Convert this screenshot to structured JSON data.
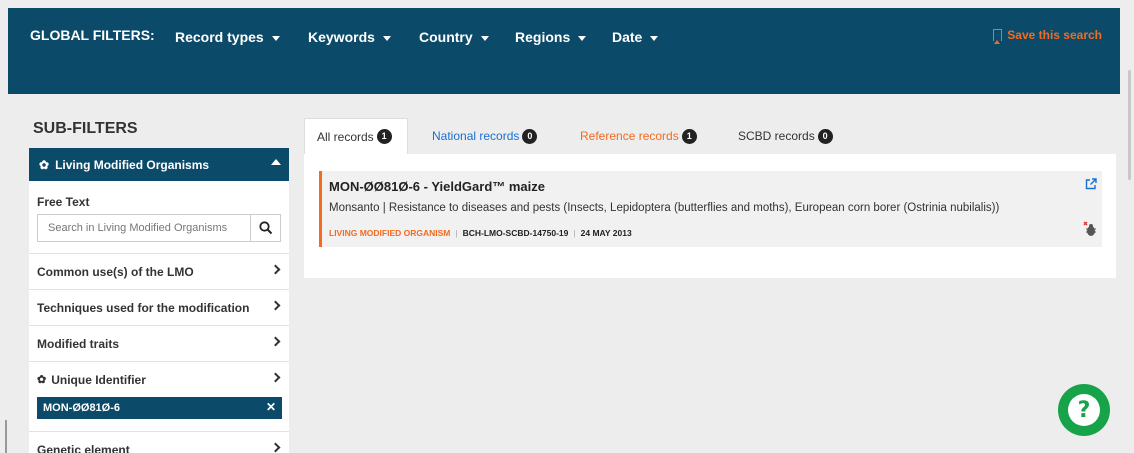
{
  "global_filters": {
    "label": "GLOBAL FILTERS:",
    "menus": [
      "Record types",
      "Keywords",
      "Country",
      "Regions",
      "Date"
    ],
    "save_search": "Save this search"
  },
  "sub_filters": {
    "title": "SUB-FILTERS",
    "section_header": "Living Modified Organisms",
    "free_text_label": "Free Text",
    "search_placeholder": "Search in Living Modified Organisms",
    "facets": [
      "Common use(s) of the LMO",
      "Techniques used for the modification",
      "Modified traits",
      "Unique Identifier",
      "Genetic element"
    ],
    "selected_chip": "MON-ØØ81Ø-6"
  },
  "tabs": [
    {
      "label": "All records",
      "count": "1",
      "color": "#333333"
    },
    {
      "label": "National records",
      "count": "0",
      "color": "#1a6fd1"
    },
    {
      "label": "Reference records",
      "count": "1",
      "color": "#f26b21"
    },
    {
      "label": "SCBD records",
      "count": "0",
      "color": "#333333"
    }
  ],
  "record": {
    "title": "MON-ØØ81Ø-6 - YieldGard™ maize",
    "description": "Monsanto | Resistance to diseases and pests (Insects, Lepidoptera (butterflies and moths), European corn borer (Ostrinia nubilalis))",
    "type": "LIVING MODIFIED ORGANISM",
    "id": "BCH-LMO-SCBD-14750-19",
    "date": "24 MAY 2013"
  },
  "colors": {
    "navy": "#0c4a6a",
    "orange": "#f26b21",
    "green": "#16a34a"
  },
  "icons": [
    "caret-down-icon",
    "bookmark-icon",
    "gear-icon",
    "caret-up-icon",
    "search-icon",
    "chevron-right-icon",
    "close-icon",
    "external-link-icon",
    "bug-icon",
    "help-icon"
  ]
}
